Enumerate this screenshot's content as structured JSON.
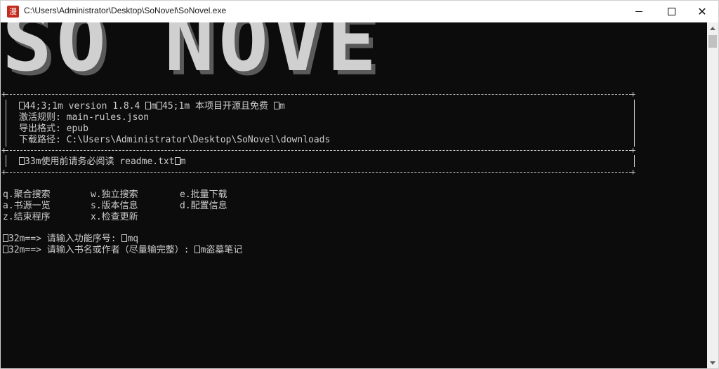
{
  "window": {
    "title": "C:\\Users\\Administrator\\Desktop\\SoNovel\\SoNovel.exe",
    "app_icon_glyph": "漫",
    "min_icon": "minimize-icon",
    "max_icon": "maximize-icon",
    "close_glyph": "✕"
  },
  "banner": {
    "logo": "SO NOVEL"
  },
  "info": {
    "version_prefix": "44;3;1m version 1.8.4 ",
    "version_mid": "m",
    "version_mid2": "45;1m 本项目开源且免费 ",
    "version_suffix": "m",
    "rules": "激活规则: main-rules.json",
    "format": "导出格式: epub",
    "path": "下载路径: C:\\Users\\Administrator\\Desktop\\SoNovel\\downloads",
    "notice_prefix": "33m使用前请务必阅读 readme.txt",
    "notice_suffix": "m"
  },
  "menu": {
    "q": "q.聚合搜索",
    "w": "w.独立搜索",
    "e": "e.批量下载",
    "a": "a.书源一览",
    "s": "s.版本信息",
    "d": "d.配置信息",
    "z": "z.结束程序",
    "x": "x.检查更新"
  },
  "prompts": {
    "p1_prefix": "32m==> 请输入功能序号: ",
    "p1_suffix": "mq",
    "p2_prefix": "32m==> 请输入书名或作者（尽量输完整）: ",
    "p2_suffix": "m盗墓笔记"
  },
  "colors": {
    "console_bg": "#0c0c0c",
    "console_fg": "#cccccc"
  }
}
